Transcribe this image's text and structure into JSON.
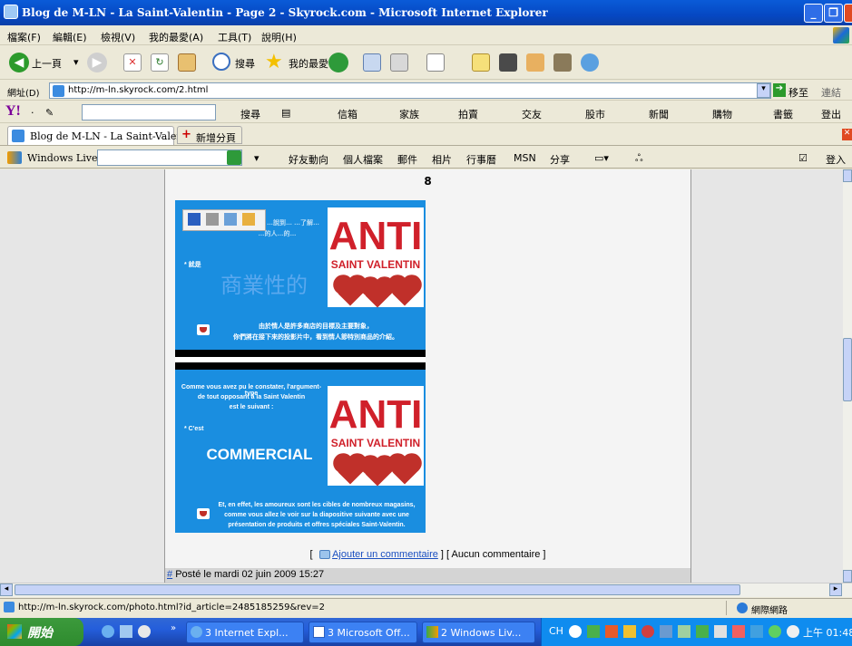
{
  "window": {
    "title": "Blog de M-LN - La Saint-Valentin - Page 2 - Skyrock.com - Microsoft Internet Explorer"
  },
  "menu": [
    "檔案(F)",
    "編輯(E)",
    "檢視(V)",
    "我的最愛(A)",
    "工具(T)",
    "說明(H)"
  ],
  "toolbar": {
    "back": "上一頁",
    "search": "搜尋",
    "favorites": "我的最愛"
  },
  "address": {
    "label": "網址(D)",
    "url": "http://m-ln.skyrock.com/2.html",
    "go": "移至",
    "links": "連結"
  },
  "yahoo": {
    "search": "搜尋",
    "items": [
      "信箱",
      "家族",
      "拍賣",
      "交友",
      "股市",
      "新聞",
      "購物",
      "書籤",
      "登出"
    ]
  },
  "tabs": {
    "active": "Blog de M-LN - La Saint-Valenti...",
    "new_tab": "新增分頁"
  },
  "live": {
    "brand": "Windows Live",
    "items": [
      "好友動向",
      "個人檔案",
      "郵件",
      "相片",
      "行事曆",
      "MSN",
      "分享"
    ],
    "signin": "登入"
  },
  "page": {
    "number": "8",
    "slide1": {
      "anti": "ANTI",
      "sv": "SAINT VALENTIN",
      "cn_top": "…說到…   …了解…",
      "cn_sub": "…的人…的…",
      "cn_bullet": "* 就是",
      "cn_big": "商業性的",
      "cn_bottom1": "由於情人是許多商店的目標及主要對象，",
      "cn_bottom2": "你們將在接下來的投影片中，看到情人節特別商品的介紹。"
    },
    "slide2": {
      "anti": "ANTI",
      "sv": "SAINT VALENTIN",
      "fr_top1": "Comme vous avez pu le constater, l'argument-type",
      "fr_top2": "de tout opposant à la Saint Valentin",
      "fr_top3": "est le suivant :",
      "fr_cest": "* C'est",
      "fr_big": "COMMERCIAL",
      "fr_b1": "Et, en effet, les amoureux sont les cibles de nombreux magasins,",
      "fr_b2": "comme vous allez le voir sur la diapositive suivante avec une",
      "fr_b3": "présentation de produits et offres spéciales Saint-Valentin."
    },
    "comment_open": "[",
    "comment_link": "Ajouter un commentaire",
    "comment_rest": "] [ Aucun commentaire ]",
    "posted_hash": "#",
    "posted": "Posté le mardi 02 juin 2009 15:27"
  },
  "status": {
    "url": "http://m-ln.skyrock.com/photo.html?id_article=2485185259&rev=2",
    "zone": "網際網路"
  },
  "taskbar": {
    "start": "開始",
    "tasks": [
      "3 Internet Expl...",
      "3 Microsoft Off...",
      "2 Windows Liv..."
    ],
    "lang": "CH",
    "clock": "上午 01:48"
  }
}
